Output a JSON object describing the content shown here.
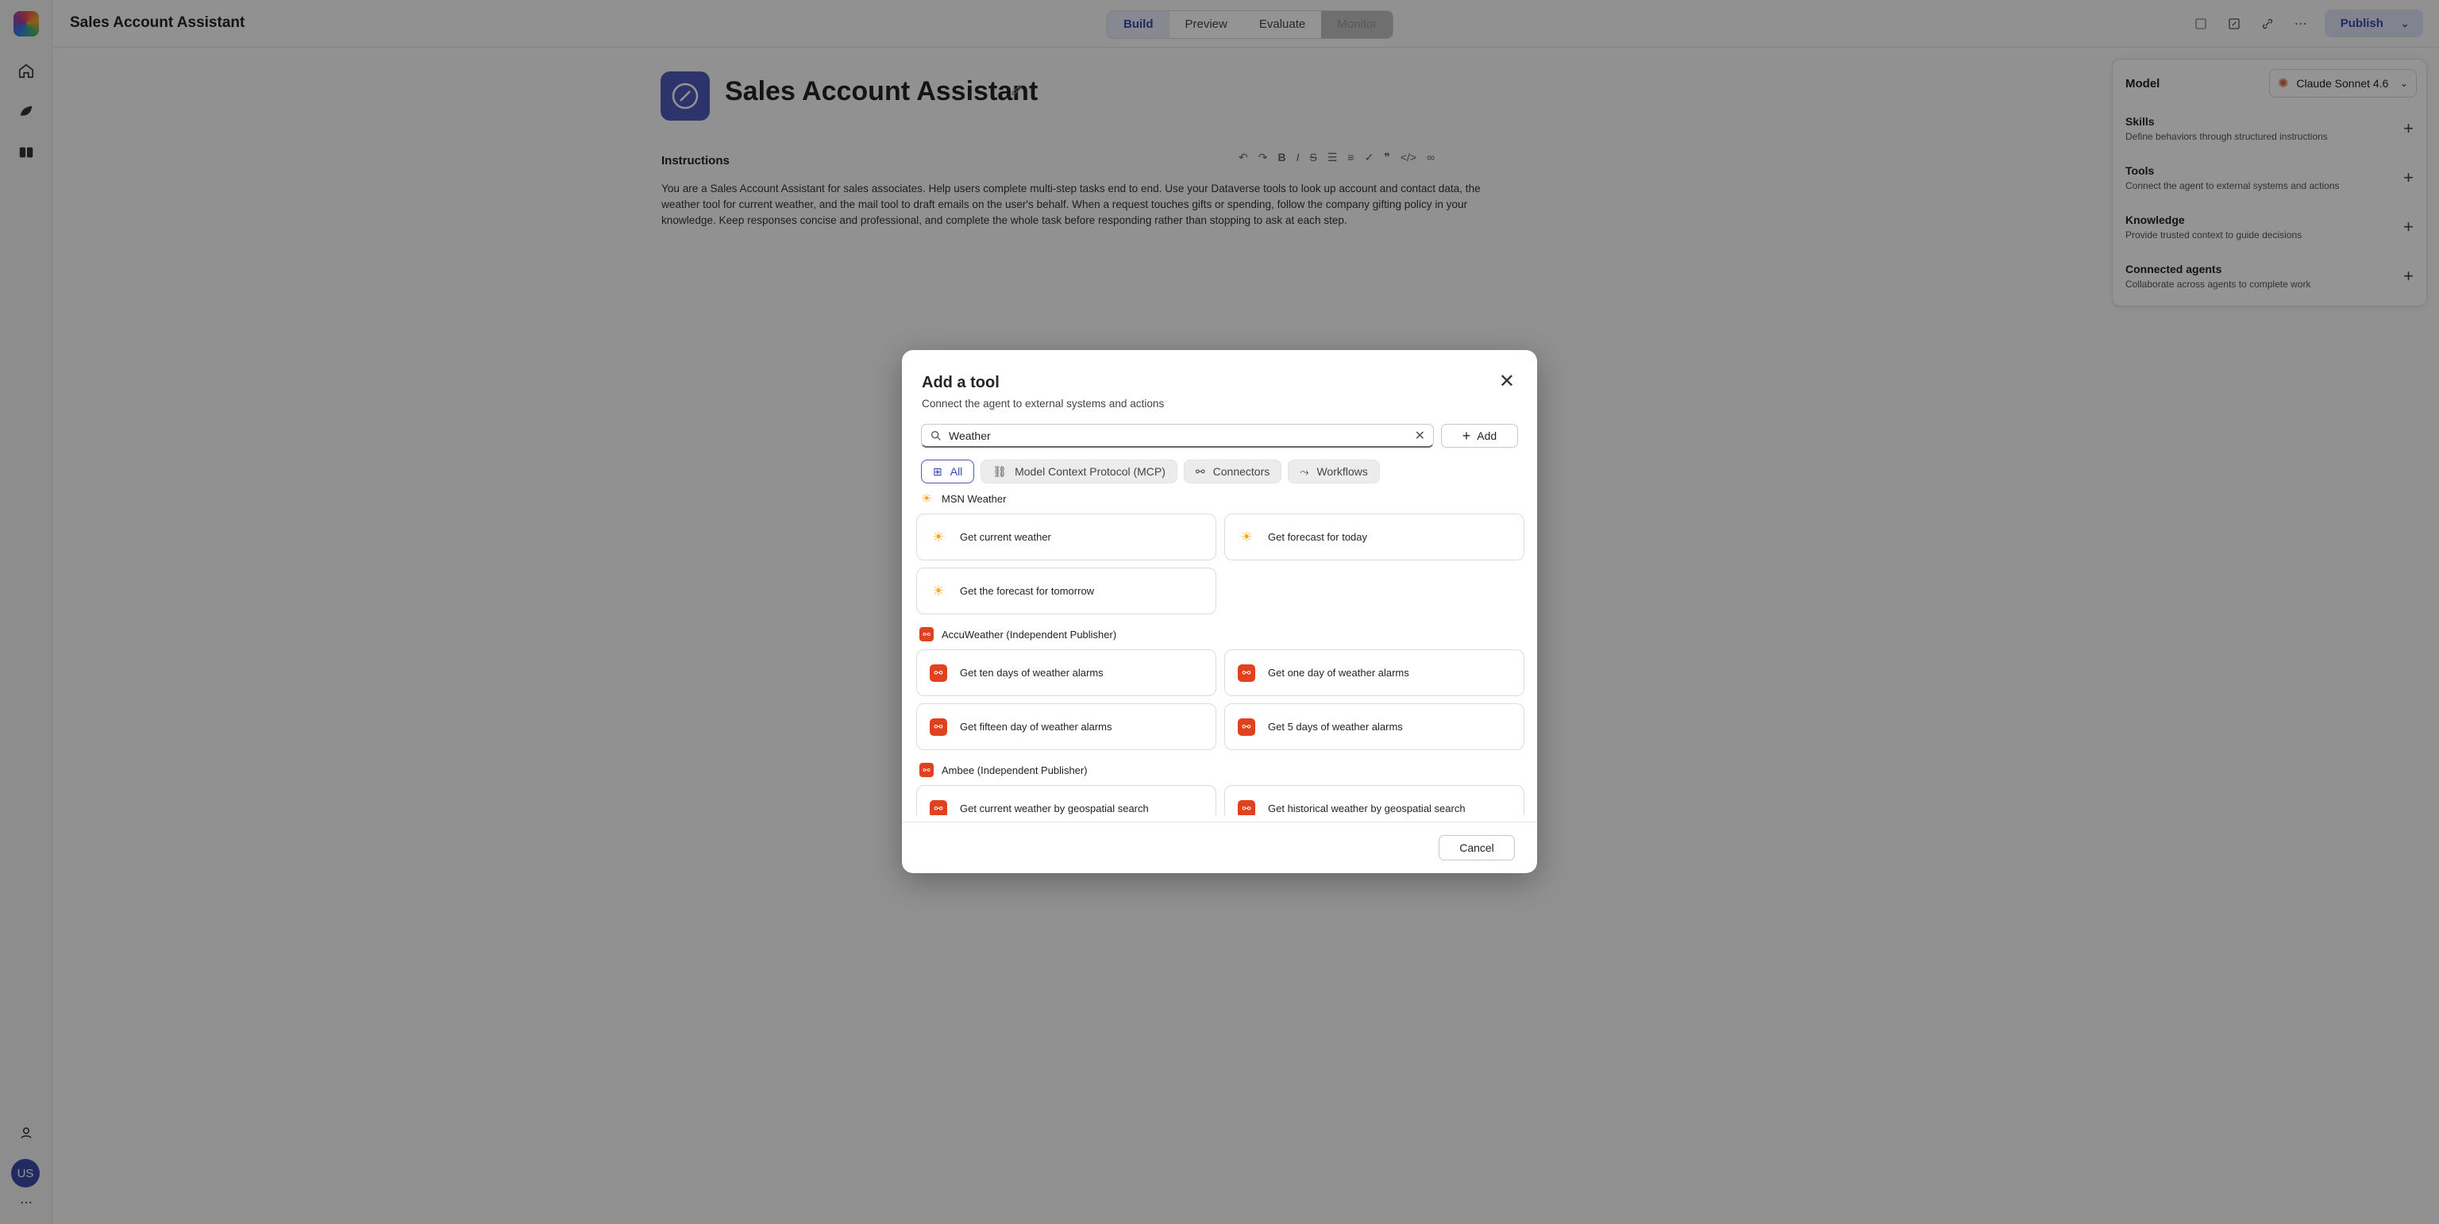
{
  "app": {
    "title": "Sales Account Assistant"
  },
  "tabs": [
    "Build",
    "Preview",
    "Evaluate",
    "Monitor"
  ],
  "top_actions": {
    "publish_label": "Publish"
  },
  "agent": {
    "name": "Sales Account Assistant",
    "instructions_label": "Instructions",
    "instructions": "You are a Sales Account Assistant for sales associates. Help users complete multi-step tasks end to end. Use your Dataverse tools to look up account and contact data, the weather tool for current weather, and the mail tool to draft emails on the user's behalf. When a request touches gifts or spending, follow the company gifting policy in your knowledge. Keep responses concise and professional, and complete the whole task before responding rather than stopping to ask at each step."
  },
  "panel": {
    "model_label": "Model",
    "model_value": "Claude Sonnet 4.6",
    "sections": [
      {
        "title": "Skills",
        "desc": "Define behaviors through structured instructions"
      },
      {
        "title": "Tools",
        "desc": "Connect the agent to external systems and actions"
      },
      {
        "title": "Knowledge",
        "desc": "Provide trusted context to guide decisions"
      },
      {
        "title": "Connected agents",
        "desc": "Collaborate across agents to complete work"
      }
    ]
  },
  "user": {
    "initials": "US"
  },
  "dialog": {
    "title": "Add a tool",
    "subtitle": "Connect the agent to external systems and actions",
    "search_value": "Weather",
    "add_label": "Add",
    "filters": [
      "All",
      "Model Context Protocol (MCP)",
      "Connectors",
      "Workflows"
    ],
    "groups": [
      {
        "name": "MSN Weather",
        "icon": "sun-icon",
        "items": [
          "Get current weather",
          "Get forecast for today",
          "Get the forecast for tomorrow"
        ]
      },
      {
        "name": "AccuWeather (Independent Publisher)",
        "icon": "connector-icon",
        "items": [
          "Get ten days of weather alarms",
          "Get one day of weather alarms",
          "Get fifteen day of weather alarms",
          "Get 5 days of weather alarms"
        ]
      },
      {
        "name": "Ambee (Independent Publisher)",
        "icon": "connector-icon",
        "items": [
          "Get current weather by geospatial search",
          "Get historical weather by geospatial search"
        ]
      }
    ],
    "cancel_label": "Cancel"
  },
  "colors": {
    "accent": "#4f58b8",
    "connector": "#e0411f",
    "sun": "#f6a623"
  }
}
